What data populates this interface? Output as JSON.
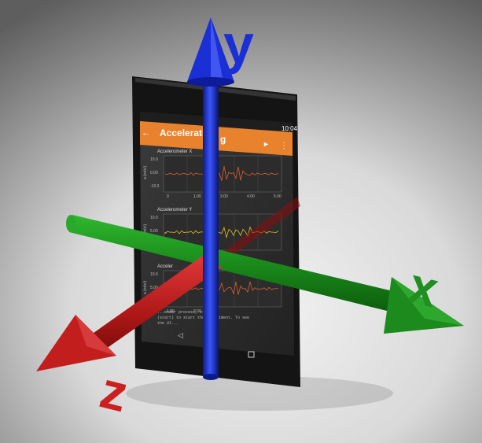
{
  "axes": {
    "x_label": "x",
    "y_label": "y",
    "z_label": "z",
    "x_color": "#1f8f1f",
    "y_color": "#1a2fd6",
    "z_color": "#cc1f1f"
  },
  "phone": {
    "status_time": "10:04",
    "app_bar_title": "Acceleratio",
    "app_bar_title_tail": "g",
    "accent_color": "#e8822c",
    "back_icon": "back-arrow-icon",
    "play_icon": "play-icon",
    "menu_icon": "more-vert-icon",
    "charts": [
      {
        "title": "Accelerometer X",
        "ylabel": "a (m/s²)",
        "yticks": [
          "10.0",
          "0.00",
          "-10.0"
        ],
        "xticks": [
          "0",
          "1.00",
          "3.00",
          "4.00",
          "5.00"
        ]
      },
      {
        "title": "Accelerometer Y",
        "ylabel": "a (m/s²)",
        "yticks": [
          "10.0",
          "5.00",
          "0.00"
        ],
        "xticks": []
      },
      {
        "title": "Acceler",
        "ylabel": "a (m/s²)",
        "yticks": [
          "10.0",
          "5.00",
          "0.00"
        ],
        "xticks": [
          "1.00",
          "3.00"
        ]
      }
    ],
    "footer_text": "...ender process, standby\n(start) to start the experiment. To see\nthe UI..."
  }
}
